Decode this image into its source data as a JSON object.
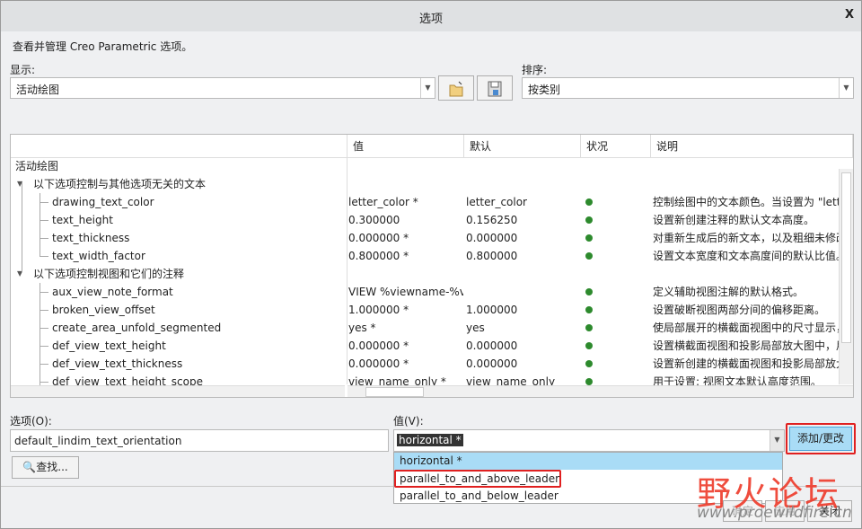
{
  "window": {
    "title": "选项",
    "close": "X"
  },
  "intro": "查看并管理 Creo Parametric 选项。",
  "display": {
    "label": "显示:",
    "value": "活动绘图"
  },
  "sort": {
    "label": "排序:",
    "value": "按类别"
  },
  "table": {
    "headers": [
      "",
      "值",
      "默认",
      "状况",
      "说明"
    ],
    "root": "活动绘图",
    "groups": [
      {
        "label": "以下选项控制与其他选项无关的文本",
        "rows": [
          {
            "name": "drawing_text_color",
            "value": "letter_color *",
            "default": "letter_color",
            "desc": "控制绘图中的文本颜色。当设置为 \"letter_color\""
          },
          {
            "name": "text_height",
            "value": "0.300000",
            "default": "0.156250",
            "desc": "设置新创建注释的默认文本高度。"
          },
          {
            "name": "text_thickness",
            "value": "0.000000 *",
            "default": "0.000000",
            "desc": "对重新生成后的新文本，以及粗细未修改的"
          },
          {
            "name": "text_width_factor",
            "value": "0.800000 *",
            "default": "0.800000",
            "desc": "设置文本宽度和文本高度间的默认比值。"
          }
        ]
      },
      {
        "label": "以下选项控制视图和它们的注释",
        "rows": [
          {
            "name": "aux_view_note_format",
            "value": "VIEW %viewname-%viewname",
            "default": "",
            "desc": "定义辅助视图注解的默认格式。"
          },
          {
            "name": "broken_view_offset",
            "value": "1.000000 *",
            "default": "1.000000",
            "desc": "设置破断视图两部分间的偏移距离。"
          },
          {
            "name": "create_area_unfold_segmented",
            "value": "yes *",
            "default": "yes",
            "desc": "使局部展开的横截面视图中的尺寸显示，"
          },
          {
            "name": "def_view_text_height",
            "value": "0.000000 *",
            "default": "0.000000",
            "desc": "设置横截面视图和投影局部放大图中，用"
          },
          {
            "name": "def_view_text_thickness",
            "value": "0.000000 *",
            "default": "0.000000",
            "desc": "设置新创建的横截面视图和投影局部放大"
          },
          {
            "name": "def_view_text_height_scope",
            "value": "view_name_only *",
            "default": "view_name_only",
            "desc": "用于设置: 视图文本默认高度范围。"
          }
        ]
      }
    ]
  },
  "option": {
    "label": "选项(O):",
    "value": "default_lindim_text_orientation",
    "find": "查找..."
  },
  "value": {
    "label": "值(V):",
    "value": "horizontal *",
    "options": [
      "horizontal *",
      "parallel_to_and_above_leader",
      "parallel_to_and_below_leader"
    ]
  },
  "add_change": "添加/更改",
  "footer": {
    "ok": "确定",
    "apply": "应用",
    "close": "关闭"
  },
  "watermark": {
    "text": "野火论坛",
    "url": "www.proewildfire.cn"
  }
}
